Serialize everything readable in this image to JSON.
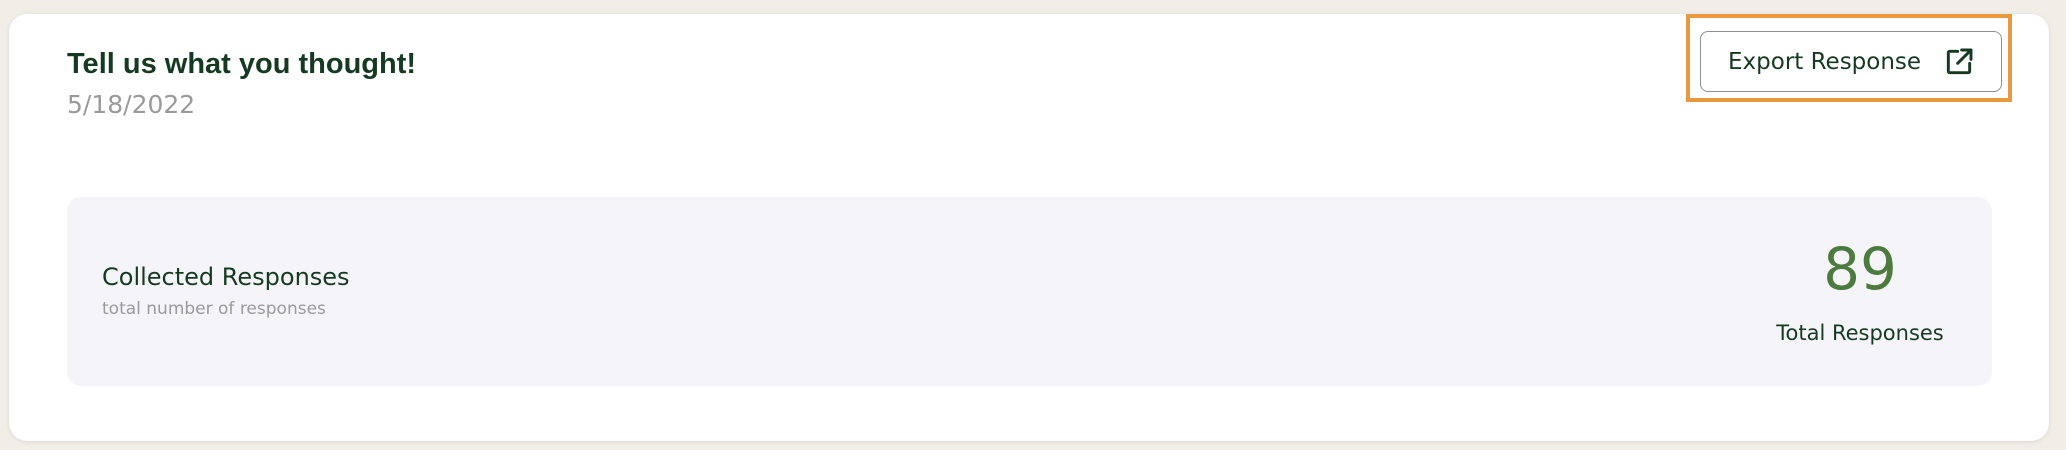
{
  "survey": {
    "title": "Tell us what you thought!",
    "date": "5/18/2022"
  },
  "toolbar": {
    "export_label": "Export Response",
    "export_icon": "external-link-icon"
  },
  "stats": {
    "title": "Collected Responses",
    "subtitle": "total number of responses",
    "total_value": "89",
    "total_label": "Total Responses"
  },
  "colors": {
    "page_background": "#f1ede7",
    "card_background": "#ffffff",
    "primary_text": "#163a21",
    "muted_text": "#9a9a9a",
    "accent_green": "#4d7a3e",
    "highlight": "#e8993f",
    "panel_background": "#f5f5f9"
  }
}
